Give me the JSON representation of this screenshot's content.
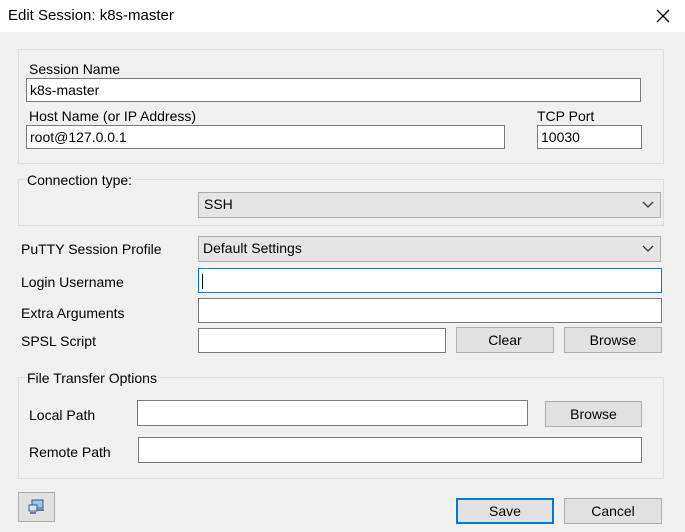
{
  "window": {
    "title": "Edit Session: k8s-master"
  },
  "session": {
    "name_label": "Session Name",
    "name_value": "k8s-master",
    "host_label": "Host Name (or IP Address)",
    "host_value": "root@127.0.0.1",
    "port_label": "TCP Port",
    "port_value": "10030"
  },
  "connection": {
    "label": "Connection type:",
    "selected": "SSH"
  },
  "profile": {
    "label": "PuTTY Session Profile",
    "selected": "Default Settings"
  },
  "login": {
    "label": "Login Username",
    "value": ""
  },
  "extra": {
    "label": "Extra Arguments",
    "value": ""
  },
  "spsl": {
    "label": "SPSL Script",
    "value": "",
    "clear_label": "Clear",
    "browse_label": "Browse"
  },
  "file_transfer": {
    "label": "File Transfer Options",
    "local_label": "Local Path",
    "local_value": "",
    "local_browse_label": "Browse",
    "remote_label": "Remote Path",
    "remote_value": ""
  },
  "footer": {
    "save_label": "Save",
    "cancel_label": "Cancel"
  },
  "icons": {
    "close": "close-icon",
    "session-tool": "computer-icon"
  },
  "colors": {
    "accent": "#0078d7",
    "window_bg": "#f0f0f0",
    "button_bg": "#e1e1e1"
  }
}
